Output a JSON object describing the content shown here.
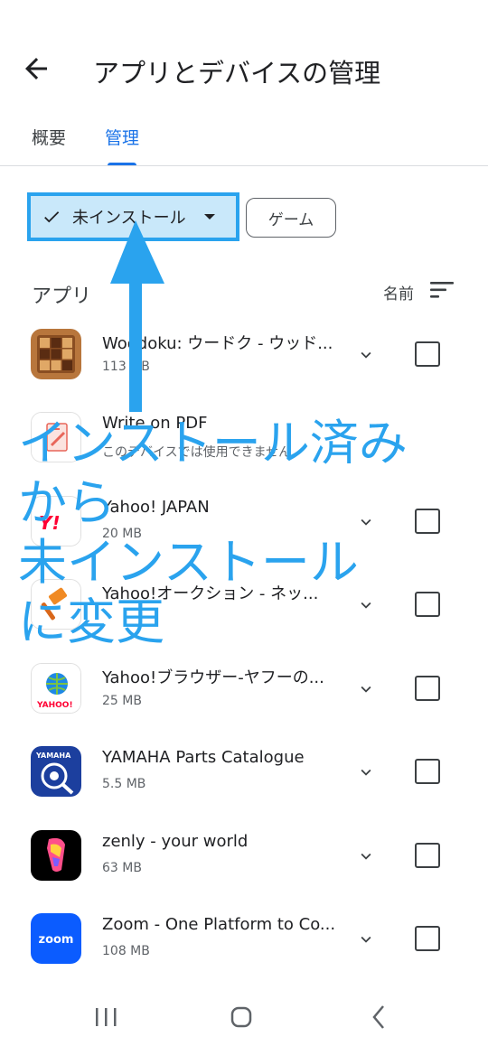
{
  "header": {
    "title": "アプリとデバイスの管理"
  },
  "tabs": [
    {
      "label": "概要",
      "active": false
    },
    {
      "label": "管理",
      "active": true
    }
  ],
  "filters": {
    "install_chip": {
      "label": "未インストール",
      "selected": true
    },
    "game_chip": {
      "label": "ゲーム"
    }
  },
  "section": {
    "title": "アプリ",
    "sort_label": "名前"
  },
  "apps": [
    {
      "name": "Woodoku: ウードク - ウッド...",
      "size": "113 MB",
      "icon": "woodoku-icon"
    },
    {
      "name": "Write on PDF",
      "size": "このデバイスでは使用できません",
      "icon": "write-on-pdf-icon"
    },
    {
      "name": "Yahoo! JAPAN",
      "size": "20 MB",
      "icon": "yahoo-japan-icon"
    },
    {
      "name": "Yahoo!オークション - ネッ...",
      "size": "",
      "icon": "yahoo-auction-icon"
    },
    {
      "name": "Yahoo!ブラウザー-ヤフーの...",
      "size": "25 MB",
      "icon": "yahoo-browser-icon"
    },
    {
      "name": "YAMAHA Parts Catalogue",
      "size": "5.5 MB",
      "icon": "yamaha-icon"
    },
    {
      "name": "zenly - your world",
      "size": "63 MB",
      "icon": "zenly-icon"
    },
    {
      "name": "Zoom - One Platform to Co...",
      "size": "108 MB",
      "icon": "zoom-icon"
    }
  ],
  "annotation": {
    "lines": [
      "インストール済み",
      "から",
      "未インストール",
      "に変更"
    ],
    "color": "#2aa3ee"
  },
  "colors": {
    "accent": "#1a73e8",
    "highlight": "#2aa3ee"
  }
}
